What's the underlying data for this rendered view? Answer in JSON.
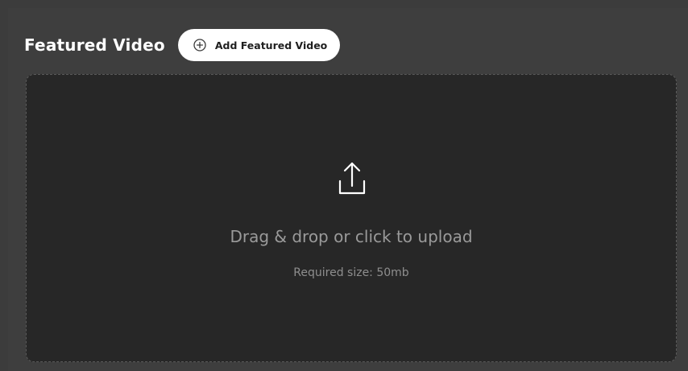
{
  "header": {
    "title": "Featured Video",
    "add_button_label": "Add Featured Video"
  },
  "dropzone": {
    "instruction": "Drag & drop or click to upload",
    "requirement": "Required size: 50mb"
  },
  "icons": {
    "add": "plus-circle-icon",
    "upload": "upload-icon"
  },
  "colors": {
    "background": "#3e3e3e",
    "dropzone_background": "#272727",
    "dropzone_border": "#5a5a5a",
    "button_background": "#ffffff",
    "title_text": "#ffffff",
    "muted_text": "#9a9a9a"
  }
}
